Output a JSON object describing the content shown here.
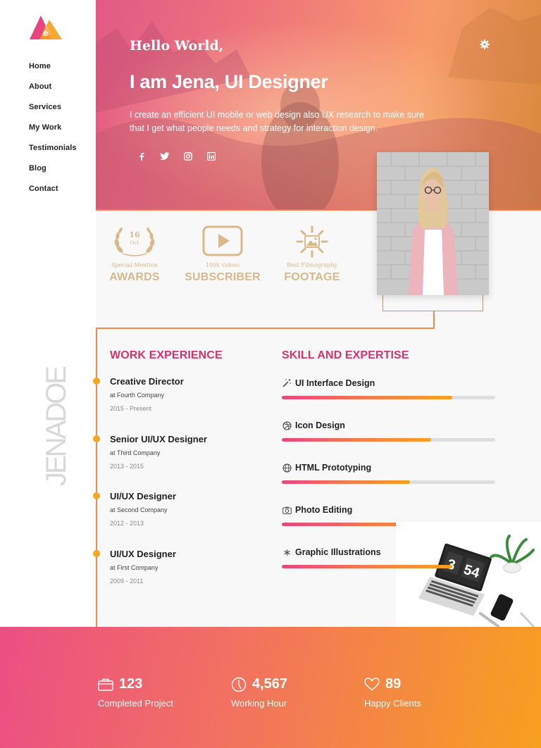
{
  "brand": {
    "logo_letter": "e",
    "colors": {
      "pink": "#e8457e",
      "orange": "#f7a01f"
    }
  },
  "nav": [
    {
      "label": "Home"
    },
    {
      "label": "About"
    },
    {
      "label": "Services"
    },
    {
      "label": "My Work"
    },
    {
      "label": "Testimonials"
    },
    {
      "label": "Blog"
    },
    {
      "label": "Contact"
    }
  ],
  "hero": {
    "greeting": "Hello World,",
    "headline": "I am  Jena, UI Designer",
    "intro": "I create an efficient UI mobile or web design also UX research to make sure that I get what people needs and strategy for interaction design.",
    "socials": [
      "facebook-icon",
      "twitter-icon",
      "instagram-icon",
      "linkedin-icon"
    ],
    "settings_icon": "gear-icon"
  },
  "badges": [
    {
      "icon": "laurel-icon",
      "day": "16",
      "month": "Oct",
      "caption": "Special Mention",
      "title": "AWARDS"
    },
    {
      "icon": "play-icon",
      "caption": "100k videos",
      "title": "SUBSCRIBER"
    },
    {
      "icon": "image-burst-icon",
      "caption": "Best Filmography",
      "title": "FOOTAGE"
    }
  ],
  "vertical_name": "JENADOE",
  "work": {
    "title": "WORK EXPERIENCE",
    "jobs": [
      {
        "title": "Creative Director",
        "company": "at Fourth Company",
        "years": "2015 - Present"
      },
      {
        "title": "Senior UI/UX Designer",
        "company": "at Third Company",
        "years": "2013 - 2015"
      },
      {
        "title": "UI/UX Designer",
        "company": "at Second Company",
        "years": "2012 - 2013"
      },
      {
        "title": "UI/UX Designer",
        "company": "at First Company",
        "years": "2009 - 2011"
      }
    ]
  },
  "skills": {
    "title": "SKILL AND EXPERTISE",
    "items": [
      {
        "name": "UI Interface Design",
        "icon": "magic-wand-icon",
        "level": 0.8
      },
      {
        "name": "Icon Design",
        "icon": "dribbble-icon",
        "level": 0.7
      },
      {
        "name": "HTML Prototyping",
        "icon": "globe-icon",
        "level": 0.6
      },
      {
        "name": "Photo Editing",
        "icon": "camera-icon",
        "level": 0.9
      },
      {
        "name": "Graphic Illustrations",
        "icon": "asterisk-icon",
        "level": 0.8
      }
    ]
  },
  "laptop_clock": {
    "hour": "3",
    "minute": "54"
  },
  "stats": [
    {
      "icon": "briefcase-icon",
      "value": "123",
      "label": "Completed Project"
    },
    {
      "icon": "clock-icon",
      "value": "4,567",
      "label": "Working Hour"
    },
    {
      "icon": "heart-icon",
      "value": "89",
      "label": "Happy Clients"
    }
  ]
}
